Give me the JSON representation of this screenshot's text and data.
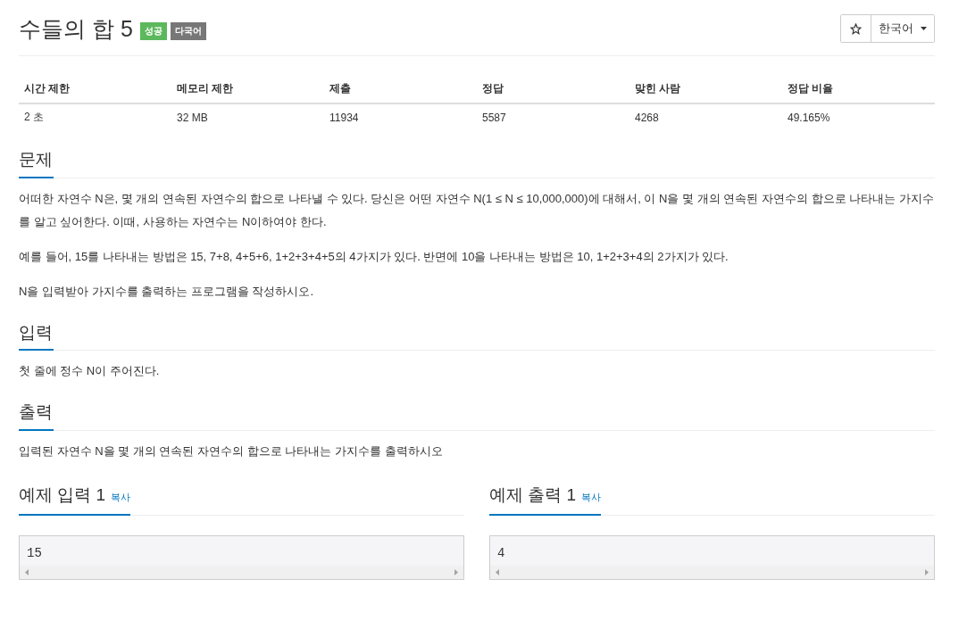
{
  "title": "수들의 합 5",
  "badges": [
    {
      "label": "성공",
      "color": "#5cb85c"
    },
    {
      "label": "다국어",
      "color": "#777777"
    }
  ],
  "language_dropdown": {
    "value": "한국어"
  },
  "stats": {
    "columns": [
      "시간 제한",
      "메모리 제한",
      "제출",
      "정답",
      "맞힌 사람",
      "정답 비율"
    ],
    "rows": [
      [
        "2 초",
        "32 MB",
        "11934",
        "5587",
        "4268",
        "49.165%"
      ]
    ]
  },
  "sections": [
    {
      "title": "문제",
      "paragraphs": [
        "어떠한 자연수 N은, 몇 개의 연속된 자연수의 합으로 나타낼 수 있다. 당신은 어떤 자연수 N(1 ≤ N ≤ 10,000,000)에 대해서, 이 N을 몇 개의 연속된 자연수의 합으로 나타내는 가지수를 알고 싶어한다. 이때, 사용하는 자연수는 N이하여야 한다.",
        "예를 들어, 15를 나타내는 방법은 15, 7+8, 4+5+6, 1+2+3+4+5의 4가지가 있다. 반면에 10을 나타내는 방법은 10, 1+2+3+4의 2가지가 있다.",
        "N을 입력받아 가지수를 출력하는 프로그램을 작성하시오."
      ]
    },
    {
      "title": "입력",
      "paragraphs": [
        "첫 줄에 정수 N이 주어진다."
      ]
    },
    {
      "title": "출력",
      "paragraphs": [
        "입력된 자연수 N을 몇 개의 연속된 자연수의 합으로 나타내는 가지수를 출력하시오"
      ]
    }
  ],
  "samples": [
    {
      "title": "예제 입력 1",
      "copy_link": "복사",
      "content": "15"
    },
    {
      "title": "예제 출력 1",
      "copy_link": "복사",
      "content": "4"
    }
  ]
}
